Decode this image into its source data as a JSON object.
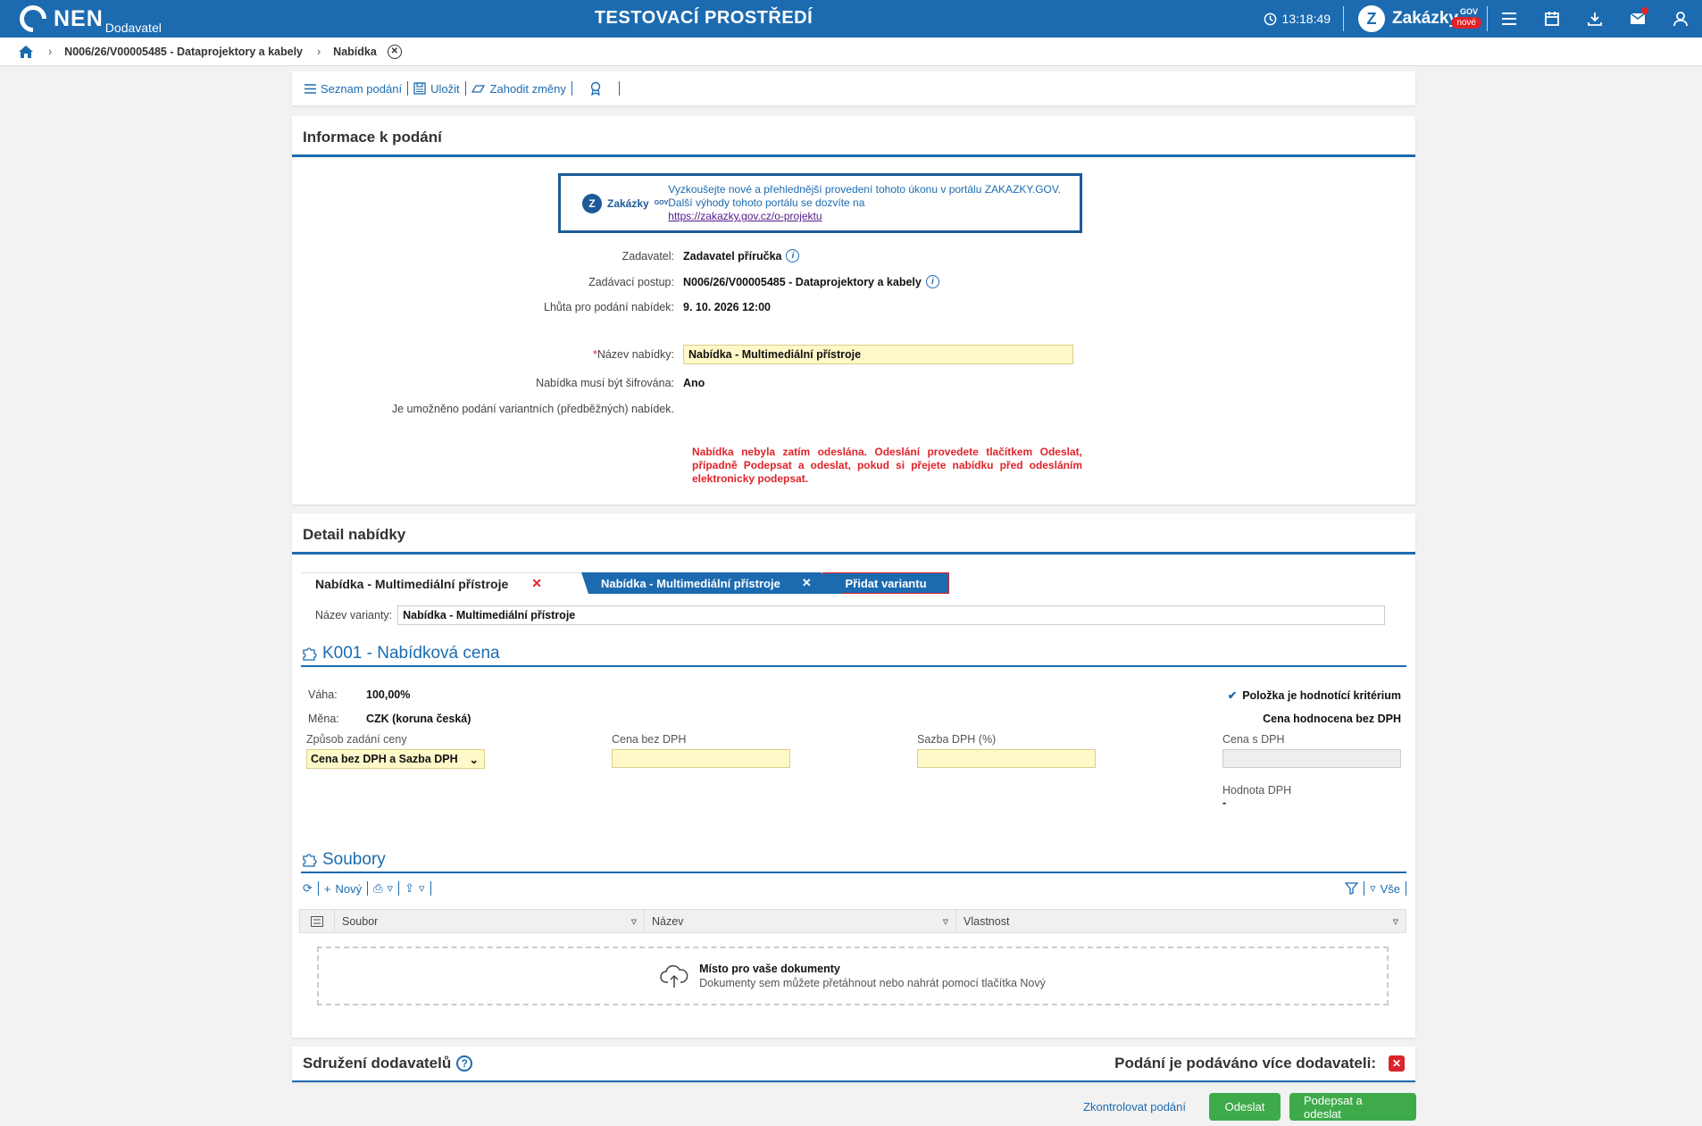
{
  "header": {
    "logo": "NEN",
    "logo_sub": "Dodavatel",
    "env_title": "TESTOVACÍ PROSTŘEDÍ",
    "time": "13:18:49",
    "zakazky": "Zakázky",
    "gov": "GOV",
    "nove": "nové",
    "icons": [
      "menu-icon",
      "calendar-icon",
      "download-icon",
      "mail-icon",
      "user-icon"
    ]
  },
  "breadcrumb": {
    "items": [
      "N006/26/V00005485 - Dataprojektory a kabely",
      "Nabídka"
    ]
  },
  "toolbar": {
    "seznam": "Seznam podání",
    "ulozit": "Uložit",
    "zahodit": "Zahodit změny"
  },
  "info": {
    "title": "Informace k podání",
    "promo_logo": "Zakázky",
    "promo_gov": "GOV",
    "promo_text": "Vyzkoušejte nové a přehlednější provedení tohoto úkonu v portálu ZAKAZKY.GOV. Další výhody tohoto portálu se dozvíte na",
    "promo_link": "https://zakazky.gov.cz/o-projektu",
    "zadavatel_label": "Zadavatel:",
    "zadavatel": "Zadavatel příručka",
    "postup_label": "Zadávací postup:",
    "postup": "N006/26/V00005485 - Dataprojektory a kabely",
    "lhuta_label": "Lhůta pro podání nabídek:",
    "lhuta": "9. 10. 2026 12:00",
    "nazev_label": "Název nabídky:",
    "nazev": "Nabídka - Multimediální přístroje",
    "sifr_label": "Nabídka musí být šifrována:",
    "sifr": "Ano",
    "varianty": "Je umožněno podání variantních (předběžných) nabídek.",
    "warning": "Nabídka nebyla zatím odeslána. Odeslání provedete tlačítkem Odeslat, případně Podepsat a odeslat, pokud si přejete nabídku před odesláním elektronicky podepsat."
  },
  "detail": {
    "title": "Detail nabídky",
    "tab1": "Nabídka - Multimediální přístroje",
    "tab2": "Nabídka - Multimediální přístroje",
    "tab3": "Přidat variantu",
    "var_label": "Název varianty:",
    "var_value": "Nabídka - Multimediální přístroje",
    "k001": "K001 - Nabídková cena",
    "vaha_label": "Váha:",
    "vaha": "100,00%",
    "mena_label": "Měna:",
    "mena": "CZK (koruna česká)",
    "kriterium": "Položka je hodnotící kritérium",
    "hodnocena": "Cena hodnocena bez DPH",
    "zpusob_label": "Způsob zadání ceny",
    "zpusob": "Cena bez DPH a Sazba DPH",
    "cena_bez_label": "Cena bez DPH",
    "sazba_label": "Sazba DPH (%)",
    "cena_s_label": "Cena s DPH",
    "hodnota_label": "Hodnota DPH",
    "hodnota": "-",
    "soubory": "Soubory",
    "novy": "Nový",
    "vse": "Vše",
    "col_soubor": "Soubor",
    "col_nazev": "Název",
    "col_vlastnost": "Vlastnost",
    "drop_title": "Místo pro vaše dokumenty",
    "drop_sub": "Dokumenty sem můžete přetáhnout nebo nahrát pomocí tlačítka Nový"
  },
  "sdruzeni": {
    "title": "Sdružení dodavatelů",
    "right": "Podání je podáváno více dodavateli:"
  },
  "actions": {
    "zkontrolovat": "Zkontrolovat podání",
    "odeslat": "Odeslat",
    "podepsat": "Podepsat a odeslat"
  }
}
